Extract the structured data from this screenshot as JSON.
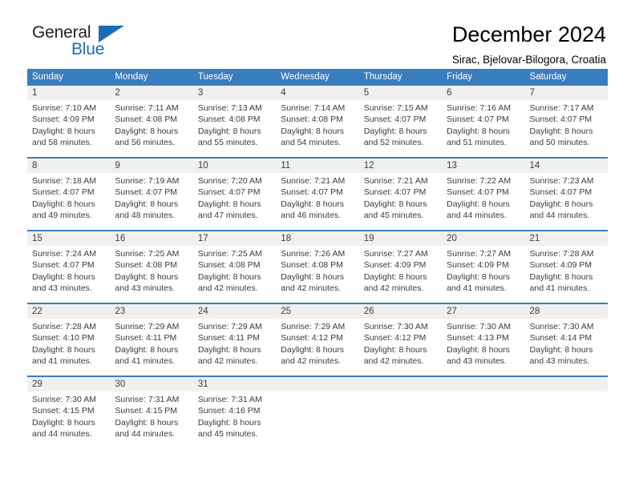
{
  "brand": {
    "name_part1": "General",
    "name_part2": "Blue",
    "accent_color": "#1b6cb5"
  },
  "header": {
    "title": "December 2024",
    "subtitle": "Sirac, Bjelovar-Bilogora, Croatia"
  },
  "calendar": {
    "header_bg": "#3a7dbf",
    "daynum_bg": "#f0f0f0",
    "weekdays": [
      "Sunday",
      "Monday",
      "Tuesday",
      "Wednesday",
      "Thursday",
      "Friday",
      "Saturday"
    ],
    "weeks": [
      [
        {
          "day": "1",
          "sunrise": "Sunrise: 7:10 AM",
          "sunset": "Sunset: 4:09 PM",
          "daylight1": "Daylight: 8 hours",
          "daylight2": "and 58 minutes."
        },
        {
          "day": "2",
          "sunrise": "Sunrise: 7:11 AM",
          "sunset": "Sunset: 4:08 PM",
          "daylight1": "Daylight: 8 hours",
          "daylight2": "and 56 minutes."
        },
        {
          "day": "3",
          "sunrise": "Sunrise: 7:13 AM",
          "sunset": "Sunset: 4:08 PM",
          "daylight1": "Daylight: 8 hours",
          "daylight2": "and 55 minutes."
        },
        {
          "day": "4",
          "sunrise": "Sunrise: 7:14 AM",
          "sunset": "Sunset: 4:08 PM",
          "daylight1": "Daylight: 8 hours",
          "daylight2": "and 54 minutes."
        },
        {
          "day": "5",
          "sunrise": "Sunrise: 7:15 AM",
          "sunset": "Sunset: 4:07 PM",
          "daylight1": "Daylight: 8 hours",
          "daylight2": "and 52 minutes."
        },
        {
          "day": "6",
          "sunrise": "Sunrise: 7:16 AM",
          "sunset": "Sunset: 4:07 PM",
          "daylight1": "Daylight: 8 hours",
          "daylight2": "and 51 minutes."
        },
        {
          "day": "7",
          "sunrise": "Sunrise: 7:17 AM",
          "sunset": "Sunset: 4:07 PM",
          "daylight1": "Daylight: 8 hours",
          "daylight2": "and 50 minutes."
        }
      ],
      [
        {
          "day": "8",
          "sunrise": "Sunrise: 7:18 AM",
          "sunset": "Sunset: 4:07 PM",
          "daylight1": "Daylight: 8 hours",
          "daylight2": "and 49 minutes."
        },
        {
          "day": "9",
          "sunrise": "Sunrise: 7:19 AM",
          "sunset": "Sunset: 4:07 PM",
          "daylight1": "Daylight: 8 hours",
          "daylight2": "and 48 minutes."
        },
        {
          "day": "10",
          "sunrise": "Sunrise: 7:20 AM",
          "sunset": "Sunset: 4:07 PM",
          "daylight1": "Daylight: 8 hours",
          "daylight2": "and 47 minutes."
        },
        {
          "day": "11",
          "sunrise": "Sunrise: 7:21 AM",
          "sunset": "Sunset: 4:07 PM",
          "daylight1": "Daylight: 8 hours",
          "daylight2": "and 46 minutes."
        },
        {
          "day": "12",
          "sunrise": "Sunrise: 7:21 AM",
          "sunset": "Sunset: 4:07 PM",
          "daylight1": "Daylight: 8 hours",
          "daylight2": "and 45 minutes."
        },
        {
          "day": "13",
          "sunrise": "Sunrise: 7:22 AM",
          "sunset": "Sunset: 4:07 PM",
          "daylight1": "Daylight: 8 hours",
          "daylight2": "and 44 minutes."
        },
        {
          "day": "14",
          "sunrise": "Sunrise: 7:23 AM",
          "sunset": "Sunset: 4:07 PM",
          "daylight1": "Daylight: 8 hours",
          "daylight2": "and 44 minutes."
        }
      ],
      [
        {
          "day": "15",
          "sunrise": "Sunrise: 7:24 AM",
          "sunset": "Sunset: 4:07 PM",
          "daylight1": "Daylight: 8 hours",
          "daylight2": "and 43 minutes."
        },
        {
          "day": "16",
          "sunrise": "Sunrise: 7:25 AM",
          "sunset": "Sunset: 4:08 PM",
          "daylight1": "Daylight: 8 hours",
          "daylight2": "and 43 minutes."
        },
        {
          "day": "17",
          "sunrise": "Sunrise: 7:25 AM",
          "sunset": "Sunset: 4:08 PM",
          "daylight1": "Daylight: 8 hours",
          "daylight2": "and 42 minutes."
        },
        {
          "day": "18",
          "sunrise": "Sunrise: 7:26 AM",
          "sunset": "Sunset: 4:08 PM",
          "daylight1": "Daylight: 8 hours",
          "daylight2": "and 42 minutes."
        },
        {
          "day": "19",
          "sunrise": "Sunrise: 7:27 AM",
          "sunset": "Sunset: 4:09 PM",
          "daylight1": "Daylight: 8 hours",
          "daylight2": "and 42 minutes."
        },
        {
          "day": "20",
          "sunrise": "Sunrise: 7:27 AM",
          "sunset": "Sunset: 4:09 PM",
          "daylight1": "Daylight: 8 hours",
          "daylight2": "and 41 minutes."
        },
        {
          "day": "21",
          "sunrise": "Sunrise: 7:28 AM",
          "sunset": "Sunset: 4:09 PM",
          "daylight1": "Daylight: 8 hours",
          "daylight2": "and 41 minutes."
        }
      ],
      [
        {
          "day": "22",
          "sunrise": "Sunrise: 7:28 AM",
          "sunset": "Sunset: 4:10 PM",
          "daylight1": "Daylight: 8 hours",
          "daylight2": "and 41 minutes."
        },
        {
          "day": "23",
          "sunrise": "Sunrise: 7:29 AM",
          "sunset": "Sunset: 4:11 PM",
          "daylight1": "Daylight: 8 hours",
          "daylight2": "and 41 minutes."
        },
        {
          "day": "24",
          "sunrise": "Sunrise: 7:29 AM",
          "sunset": "Sunset: 4:11 PM",
          "daylight1": "Daylight: 8 hours",
          "daylight2": "and 42 minutes."
        },
        {
          "day": "25",
          "sunrise": "Sunrise: 7:29 AM",
          "sunset": "Sunset: 4:12 PM",
          "daylight1": "Daylight: 8 hours",
          "daylight2": "and 42 minutes."
        },
        {
          "day": "26",
          "sunrise": "Sunrise: 7:30 AM",
          "sunset": "Sunset: 4:12 PM",
          "daylight1": "Daylight: 8 hours",
          "daylight2": "and 42 minutes."
        },
        {
          "day": "27",
          "sunrise": "Sunrise: 7:30 AM",
          "sunset": "Sunset: 4:13 PM",
          "daylight1": "Daylight: 8 hours",
          "daylight2": "and 43 minutes."
        },
        {
          "day": "28",
          "sunrise": "Sunrise: 7:30 AM",
          "sunset": "Sunset: 4:14 PM",
          "daylight1": "Daylight: 8 hours",
          "daylight2": "and 43 minutes."
        }
      ],
      [
        {
          "day": "29",
          "sunrise": "Sunrise: 7:30 AM",
          "sunset": "Sunset: 4:15 PM",
          "daylight1": "Daylight: 8 hours",
          "daylight2": "and 44 minutes."
        },
        {
          "day": "30",
          "sunrise": "Sunrise: 7:31 AM",
          "sunset": "Sunset: 4:15 PM",
          "daylight1": "Daylight: 8 hours",
          "daylight2": "and 44 minutes."
        },
        {
          "day": "31",
          "sunrise": "Sunrise: 7:31 AM",
          "sunset": "Sunset: 4:16 PM",
          "daylight1": "Daylight: 8 hours",
          "daylight2": "and 45 minutes."
        },
        {
          "day": "",
          "sunrise": "",
          "sunset": "",
          "daylight1": "",
          "daylight2": ""
        },
        {
          "day": "",
          "sunrise": "",
          "sunset": "",
          "daylight1": "",
          "daylight2": ""
        },
        {
          "day": "",
          "sunrise": "",
          "sunset": "",
          "daylight1": "",
          "daylight2": ""
        },
        {
          "day": "",
          "sunrise": "",
          "sunset": "",
          "daylight1": "",
          "daylight2": ""
        }
      ]
    ]
  }
}
